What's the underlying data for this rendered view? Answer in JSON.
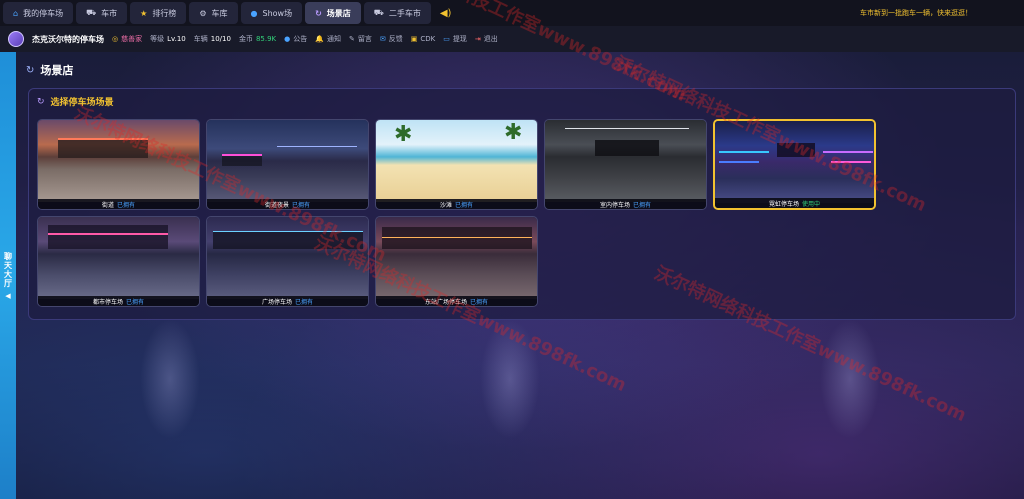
{
  "nav": {
    "tabs": [
      {
        "label": "我的停车场",
        "icon": "home-icon"
      },
      {
        "label": "车市",
        "icon": "car-icon"
      },
      {
        "label": "排行榜",
        "icon": "star-icon"
      },
      {
        "label": "车库",
        "icon": "gear-icon"
      },
      {
        "label": "Show场",
        "icon": "info-icon"
      },
      {
        "label": "场景店",
        "icon": "refresh-icon"
      },
      {
        "label": "二手车市",
        "icon": "car-icon"
      }
    ],
    "active_tab": "场景店",
    "marquee": "车市新到一批跑车一辆，快来逛逛！"
  },
  "user": {
    "name": "杰克沃尔特的停车场",
    "title": "慈善家",
    "level_label": "等级",
    "level": "Lv.10",
    "slots_label": "车辆",
    "slots": "10/10",
    "coins_label": "金币",
    "coins": "85.9K",
    "actions": [
      {
        "label": "公告",
        "icon": "info-icon"
      },
      {
        "label": "通知",
        "icon": "bell-icon"
      },
      {
        "label": "留言",
        "icon": "pin-icon"
      },
      {
        "label": "反馈",
        "icon": "chat-icon"
      },
      {
        "label": "CDK",
        "icon": "gift-icon"
      },
      {
        "label": "提现",
        "icon": "wallet-icon"
      },
      {
        "label": "退出",
        "icon": "logout-icon"
      }
    ]
  },
  "chat": {
    "label": "聊天大厅"
  },
  "page": {
    "title": "场景店"
  },
  "panel": {
    "title": "选择停车场场景"
  },
  "scenes": [
    {
      "name": "街道",
      "status": "已拥有",
      "style": "s-street",
      "in_use": false
    },
    {
      "name": "街道夜景",
      "status": "已拥有",
      "style": "s-streetnight",
      "in_use": false
    },
    {
      "name": "沙滩",
      "status": "已拥有",
      "style": "s-beach",
      "in_use": false
    },
    {
      "name": "室内停车场",
      "status": "已拥有",
      "style": "s-indoor",
      "in_use": false
    },
    {
      "name": "霓虹停车场",
      "status": "使用中",
      "style": "s-neon",
      "in_use": true
    },
    {
      "name": "都市停车场",
      "status": "已拥有",
      "style": "s-city",
      "in_use": false
    },
    {
      "name": "广场停车场",
      "status": "已拥有",
      "style": "s-plaza",
      "in_use": false
    },
    {
      "name": "东站广场停车场",
      "status": "已拥有",
      "style": "s-eastplaza",
      "in_use": false
    }
  ],
  "watermark": "沃尔特网络科技工作室www.898fk.com",
  "colors": {
    "accent": "#f2c230",
    "owned": "#4aa3ff",
    "in_use": "#33d17a",
    "chat_tab": "#2aa8e8"
  }
}
